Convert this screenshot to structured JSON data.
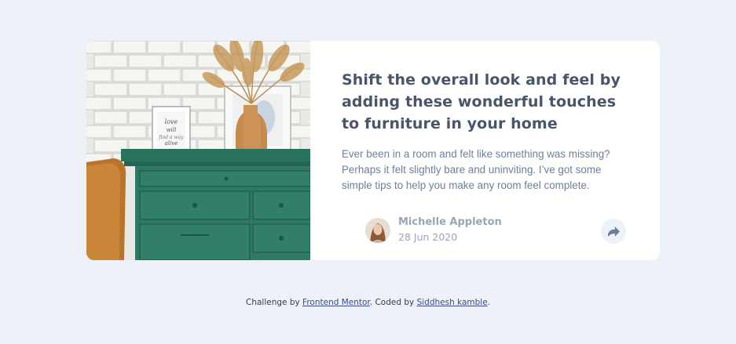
{
  "card": {
    "title": "Shift the overall look and feel by adding these wonderful touches to furniture in your home",
    "description": "Ever been in a room and felt like something was missing? Perhaps it felt slightly bare and uninviting. I’ve got some simple tips to help you make any room feel complete.",
    "author": {
      "name": "Michelle Appleton",
      "date": "28 Jun 2020"
    },
    "share_icon": "share-arrow-icon",
    "photo_frame_text": "love will find a way alive"
  },
  "attribution": {
    "prefix": "Challenge by ",
    "link1": "Frontend Mentor",
    "middle": ". Coded by ",
    "link2": "Siddhesh kamble",
    "suffix": "."
  },
  "colors": {
    "background": "#ecf2f8",
    "card": "#ffffff",
    "title": "#48556a",
    "text": "#6e8098",
    "muted": "#9aa5b6",
    "dresser": "#2f7a66"
  }
}
